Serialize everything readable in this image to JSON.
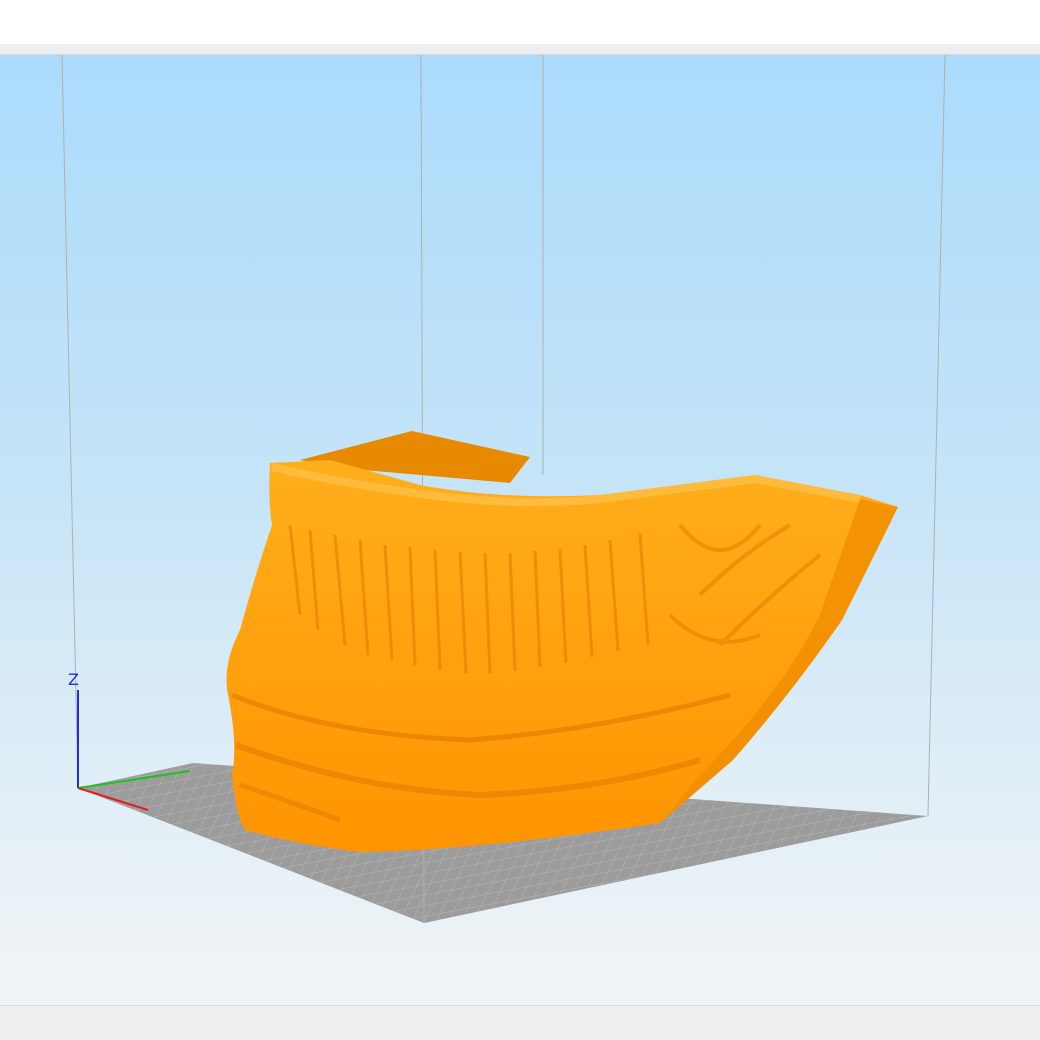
{
  "viewport": {
    "axis_labels": {
      "z": "Z"
    },
    "colors": {
      "model": "#ff9d00",
      "model_shadow": "#e07a00",
      "model_highlight": "#ffb52e",
      "build_plate": "#9c9c9c",
      "grid_line": "#bdbdbd",
      "volume_edge": "#b0b0b0",
      "axis_x": "#e02020",
      "axis_y": "#20c020",
      "axis_z": "#2030e0"
    },
    "icons": [
      "axis-gizmo-icon"
    ]
  }
}
